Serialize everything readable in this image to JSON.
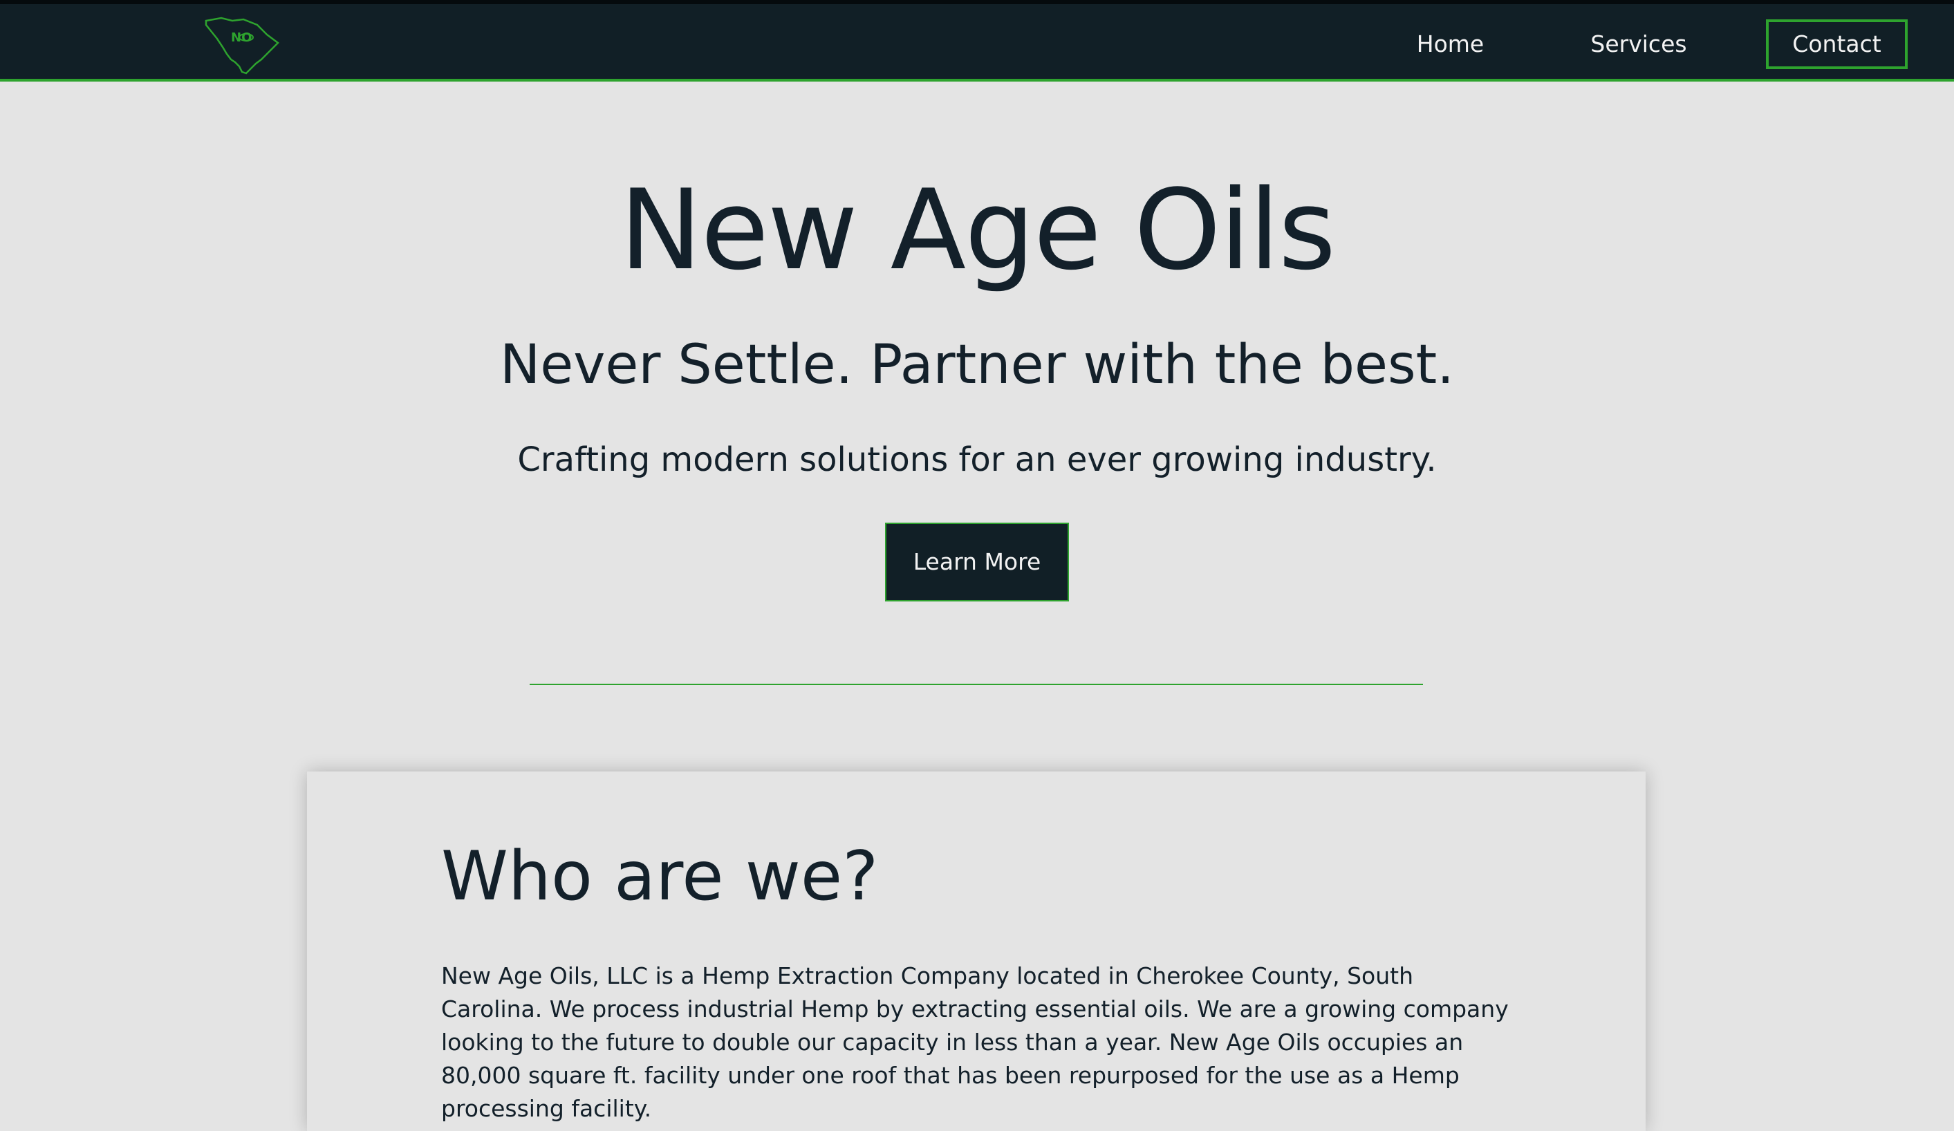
{
  "nav": {
    "logo_icon": "south-carolina-state-outline-logo",
    "home_label": "Home",
    "services_label": "Services",
    "contact_label": "Contact"
  },
  "hero": {
    "title": "New Age Oils",
    "tagline": "Never Settle. Partner with the best.",
    "subtitle": "Crafting modern solutions for an ever growing industry.",
    "cta_label": "Learn More"
  },
  "about": {
    "title": "Who are we?",
    "body": "New Age Oils, LLC is a Hemp Extraction Company located in Cherokee County, South Carolina. We process industrial Hemp by extracting essential oils. We are a growing company looking to the future to double our capacity in less than a year. New Age Oils occupies an 80,000 square ft. facility under one roof that has been repurposed for the use as a Hemp processing facility."
  },
  "colors": {
    "navbar_bg": "#111f26",
    "accent_green": "#2ea32e",
    "page_bg": "#e4e4e4",
    "text_dark": "#13202a"
  }
}
